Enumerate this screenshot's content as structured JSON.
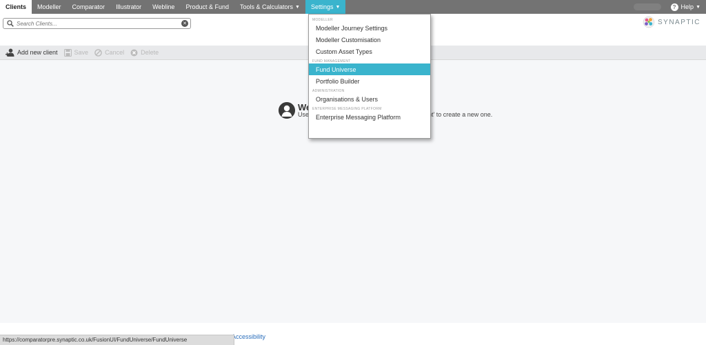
{
  "nav": {
    "tabs": [
      {
        "label": "Clients"
      },
      {
        "label": "Modeller"
      },
      {
        "label": "Comparator"
      },
      {
        "label": "Illustrator"
      },
      {
        "label": "Webline"
      },
      {
        "label": "Product & Fund"
      },
      {
        "label": "Tools & Calculators"
      },
      {
        "label": "Settings"
      }
    ],
    "help_label": "Help"
  },
  "search": {
    "placeholder": "Search Clients..."
  },
  "brand": {
    "name": "SYNAPTIC"
  },
  "toolbar": {
    "add_label": "Add new client",
    "save_label": "Save",
    "cancel_label": "Cancel",
    "delete_label": "Delete"
  },
  "welcome": {
    "title": "We",
    "text_start": "Use",
    "text_end": "ent' to create a new one."
  },
  "settings_menu": {
    "sections": [
      {
        "label": "MODELLER",
        "items": [
          {
            "label": "Modeller Journey Settings"
          },
          {
            "label": "Modeller Customisation"
          },
          {
            "label": "Custom Asset Types"
          }
        ]
      },
      {
        "label": "FUND MANAGEMENT",
        "items": [
          {
            "label": "Fund Universe"
          },
          {
            "label": "Portfolio Builder"
          }
        ]
      },
      {
        "label": "ADMINISTRATION",
        "items": [
          {
            "label": "Organisations & Users"
          }
        ]
      },
      {
        "label": "ENTERPRISE MESSAGING PLATFORM",
        "items": [
          {
            "label": "Enterprise Messaging Platform"
          }
        ]
      }
    ],
    "selected": "Fund Universe"
  },
  "footer": {
    "accessibility_label": "Accessibility"
  },
  "status_url": "https://comparatorpre.synaptic.co.uk/FusionUI/FundUniverse/FundUniverse",
  "colors": {
    "nav_bg": "#737373",
    "accent": "#3ab4cd",
    "link": "#2a6ebb"
  }
}
